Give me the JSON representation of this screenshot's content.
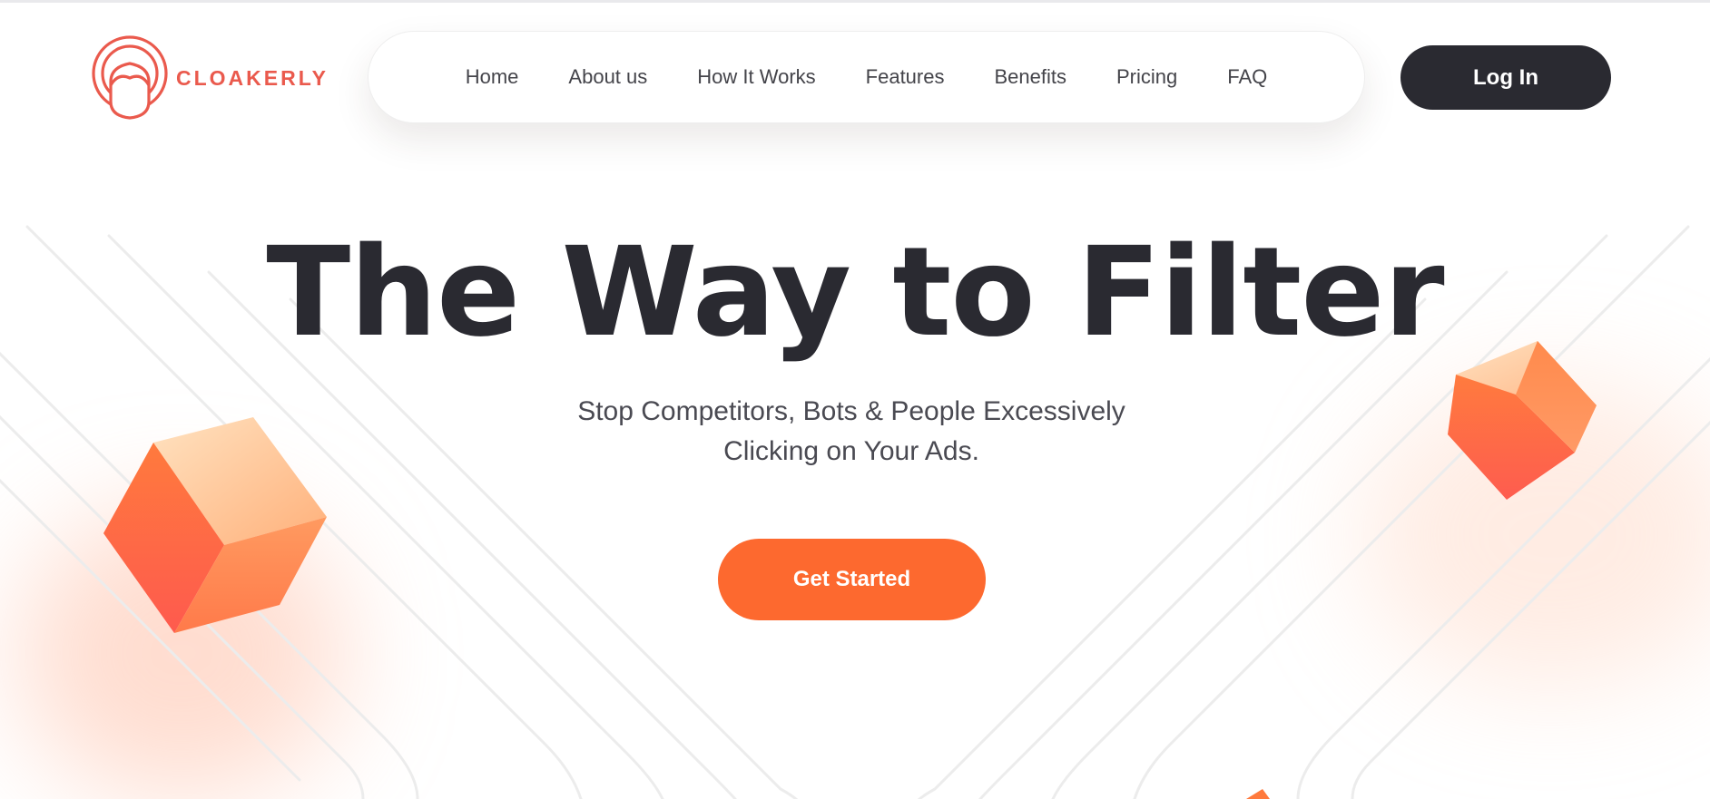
{
  "brand": {
    "name": "CLOAKERLY",
    "logo_icon": "masked-face-icon",
    "color": "#ea5a4d"
  },
  "nav": {
    "items": [
      {
        "label": "Home"
      },
      {
        "label": "About us"
      },
      {
        "label": "How It Works"
      },
      {
        "label": "Features"
      },
      {
        "label": "Benefits"
      },
      {
        "label": "Pricing"
      },
      {
        "label": "FAQ"
      }
    ]
  },
  "header": {
    "login_label": "Log In"
  },
  "hero": {
    "title": "The Way to Filter",
    "subtitle_line1": "Stop Competitors, Bots & People Excessively",
    "subtitle_line2": "Clicking on Your Ads.",
    "cta_label": "Get Started"
  },
  "colors": {
    "accent": "#fd692f",
    "dark": "#2a2a31",
    "text": "#4a4a52"
  }
}
